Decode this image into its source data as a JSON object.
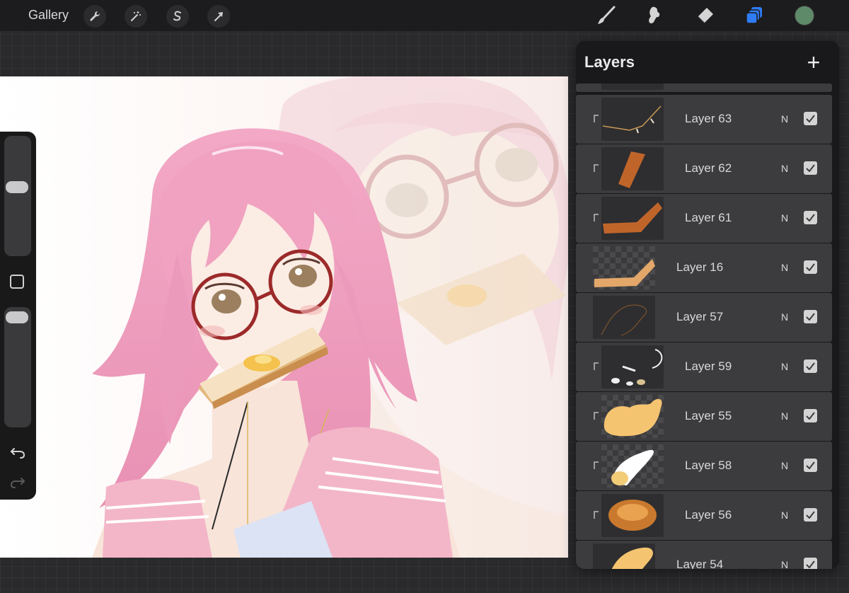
{
  "toolbar": {
    "gallery_label": "Gallery",
    "actions": [
      "wrench-icon",
      "magic-wand-icon",
      "selection-icon",
      "transform-icon"
    ],
    "tools": [
      "brush-icon",
      "smudge-icon",
      "eraser-icon",
      "layers-icon"
    ],
    "active_tool": "layers-icon",
    "active_color": "#5f8a6a",
    "accent": "#2f7cf6"
  },
  "sidebar": {
    "brush_size": 0.15,
    "opacity": 0.05
  },
  "layers_panel": {
    "title": "Layers",
    "add_button": "+",
    "layers": [
      {
        "name": "Layer 63",
        "blend": "N",
        "visible": true,
        "clipped": true
      },
      {
        "name": "Layer 62",
        "blend": "N",
        "visible": true,
        "clipped": true
      },
      {
        "name": "Layer 61",
        "blend": "N",
        "visible": true,
        "clipped": true
      },
      {
        "name": "Layer 16",
        "blend": "N",
        "visible": true,
        "clipped": false
      },
      {
        "name": "Layer 57",
        "blend": "N",
        "visible": true,
        "clipped": false
      },
      {
        "name": "Layer 59",
        "blend": "N",
        "visible": true,
        "clipped": true
      },
      {
        "name": "Layer 55",
        "blend": "N",
        "visible": true,
        "clipped": true
      },
      {
        "name": "Layer 58",
        "blend": "N",
        "visible": true,
        "clipped": true
      },
      {
        "name": "Layer 56",
        "blend": "N",
        "visible": true,
        "clipped": true
      },
      {
        "name": "Layer 54",
        "blend": "N",
        "visible": true,
        "clipped": false
      }
    ]
  }
}
